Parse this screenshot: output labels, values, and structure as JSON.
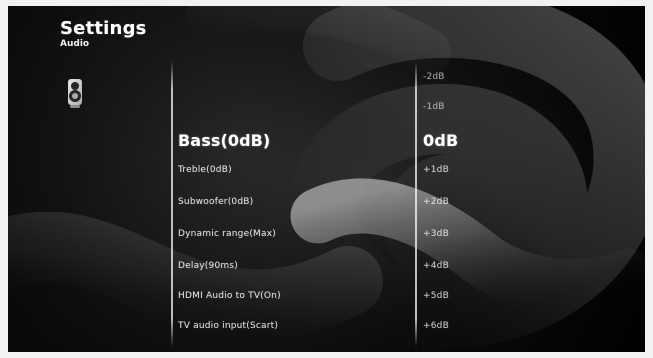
{
  "header": {
    "title": "Settings",
    "subtitle": "Audio"
  },
  "menu": {
    "items": [
      {
        "label": "Bass(0dB)"
      },
      {
        "label": "Treble(0dB)"
      },
      {
        "label": "Subwoofer(0dB)"
      },
      {
        "label": "Dynamic range(Max)"
      },
      {
        "label": "Delay(90ms)"
      },
      {
        "label": "HDMI Audio to TV(On)"
      },
      {
        "label": "TV audio input(Scart)"
      }
    ]
  },
  "values": {
    "items": [
      {
        "label": "-2dB"
      },
      {
        "label": "-1dB"
      },
      {
        "label": "0dB"
      },
      {
        "label": "+1dB"
      },
      {
        "label": "+2dB"
      },
      {
        "label": "+3dB"
      },
      {
        "label": "+4dB"
      },
      {
        "label": "+5dB"
      },
      {
        "label": "+6dB"
      }
    ]
  },
  "icons": {
    "speaker": "speaker-icon"
  }
}
